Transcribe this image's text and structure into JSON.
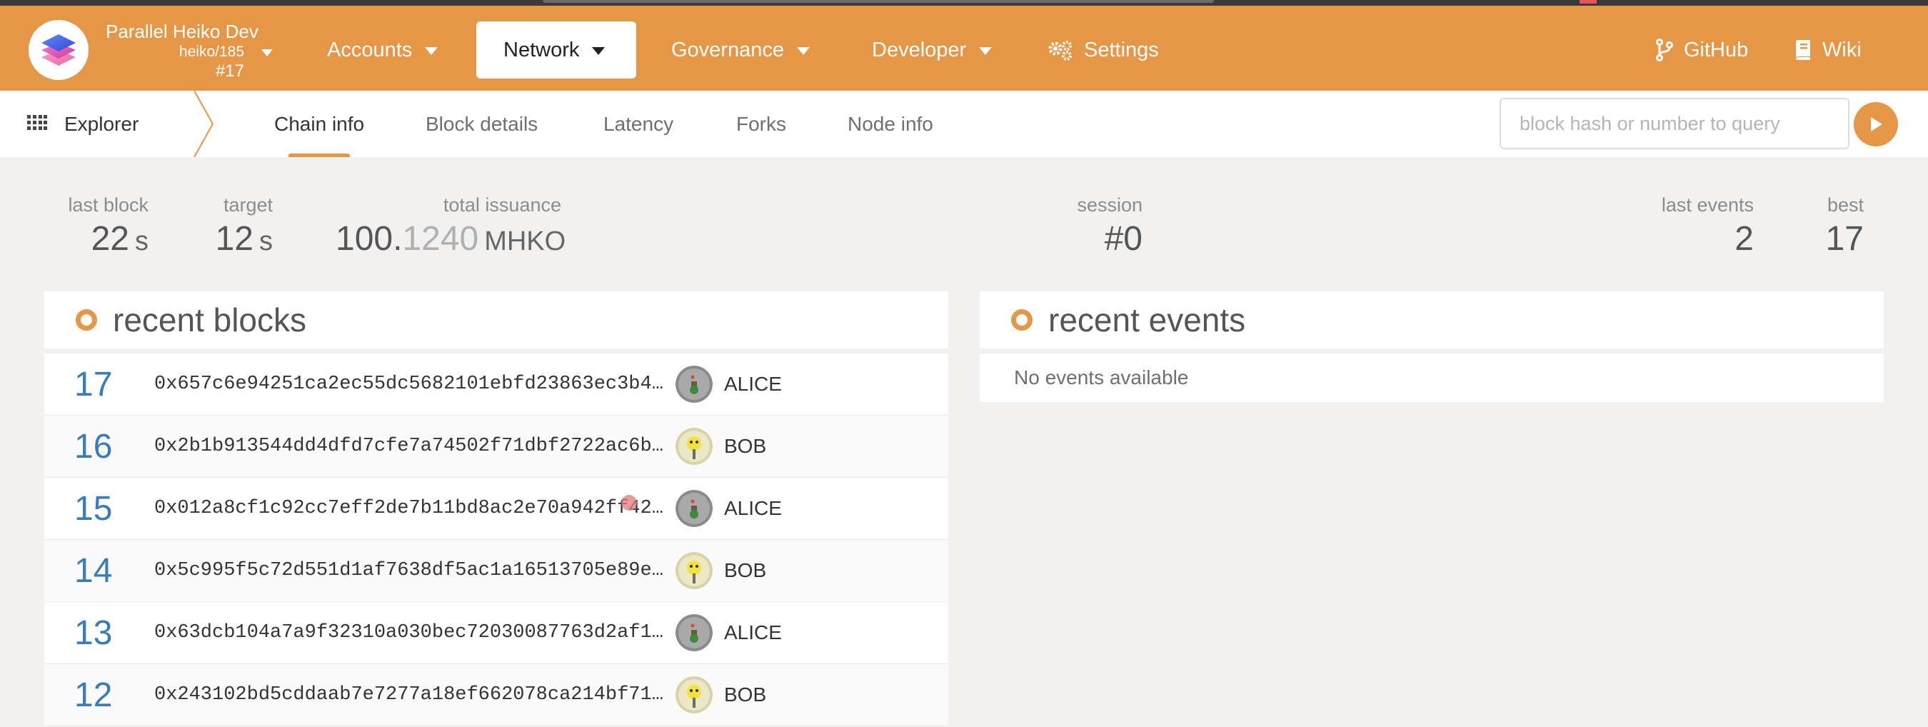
{
  "colors": {
    "accent": "#e59646",
    "block_number": "#3a7cb8"
  },
  "chain": {
    "name": "Parallel Heiko Dev",
    "spec": "heiko/185",
    "block": "#17"
  },
  "nav": {
    "accounts": "Accounts",
    "network": "Network",
    "governance": "Governance",
    "developer": "Developer",
    "settings": "Settings",
    "github": "GitHub",
    "wiki": "Wiki"
  },
  "subnav": {
    "explorer": "Explorer",
    "tabs": [
      "Chain info",
      "Block details",
      "Latency",
      "Forks",
      "Node info"
    ],
    "active_tab": "Chain info",
    "query_placeholder": "block hash or number to query",
    "query_value": ""
  },
  "summary": {
    "last_block": {
      "label": "last block",
      "value": "22",
      "unit": "s"
    },
    "target": {
      "label": "target",
      "value": "12",
      "unit": "s"
    },
    "total_issuance": {
      "label": "total issuance",
      "value_main": "100.",
      "value_dim": "1240",
      "unit": "MHKO"
    },
    "session": {
      "label": "session",
      "value": "#0"
    },
    "last_events": {
      "label": "last events",
      "value": "2"
    },
    "best": {
      "label": "best",
      "value": "17"
    }
  },
  "recent_blocks": {
    "title": "recent blocks",
    "rows": [
      {
        "number": "17",
        "hash": "0x657c6e94251ca2ec55dc5682101ebfd23863ec3b4…",
        "author": "ALICE",
        "avatar": "alice-identicon"
      },
      {
        "number": "16",
        "hash": "0x2b1b913544dd4dfd7cfe7a74502f71dbf2722ac6b…",
        "author": "BOB",
        "avatar": "bob-identicon"
      },
      {
        "number": "15",
        "hash": "0x012a8cf1c92cc7eff2de7b11bd8ac2e70a942ff42…",
        "author": "ALICE",
        "avatar": "alice-identicon"
      },
      {
        "number": "14",
        "hash": "0x5c995f5c72d551d1af7638df5ac1a16513705e89e…",
        "author": "BOB",
        "avatar": "bob-identicon"
      },
      {
        "number": "13",
        "hash": "0x63dcb104a7a9f32310a030bec72030087763d2af1…",
        "author": "ALICE",
        "avatar": "alice-identicon"
      },
      {
        "number": "12",
        "hash": "0x243102bd5cddaab7e7277a18ef662078ca214bf71…",
        "author": "BOB",
        "avatar": "bob-identicon"
      }
    ]
  },
  "recent_events": {
    "title": "recent events",
    "empty": "No events available"
  }
}
